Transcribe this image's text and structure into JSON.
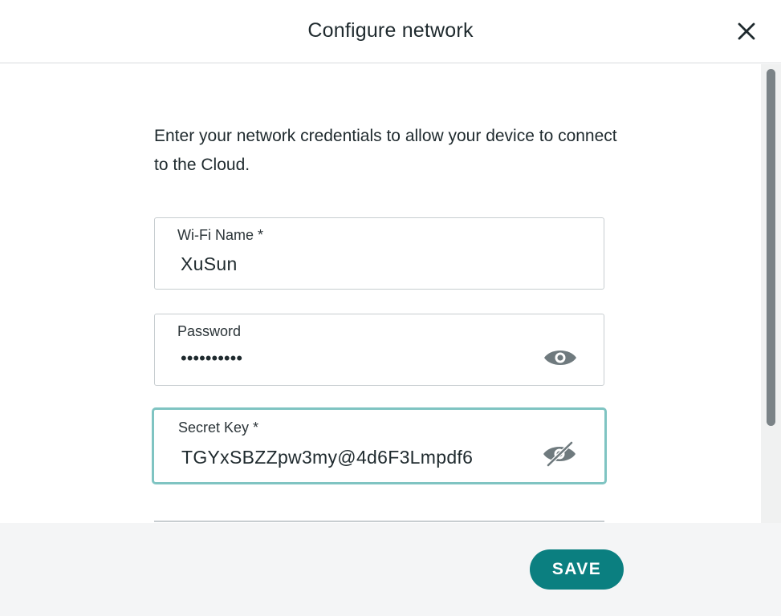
{
  "dialog": {
    "title": "Configure network",
    "close_icon": "close-icon"
  },
  "intro_text": "Enter your network credentials to allow your device to connect to the Cloud.",
  "fields": {
    "wifi_name": {
      "label": "Wi-Fi Name *",
      "value": "XuSun"
    },
    "password": {
      "label": "Password",
      "value": "••••••••••",
      "icon": "eye-icon"
    },
    "secret_key": {
      "label": "Secret Key *",
      "value": "TGYxSBZZpw3my@4d6F3Lmpdf6",
      "icon": "eye-slash-icon"
    }
  },
  "footer": {
    "save_label": "SAVE"
  },
  "colors": {
    "accent": "#0b7f80",
    "focus_border": "#7fc4c2",
    "icon": "#6f7a7e"
  }
}
